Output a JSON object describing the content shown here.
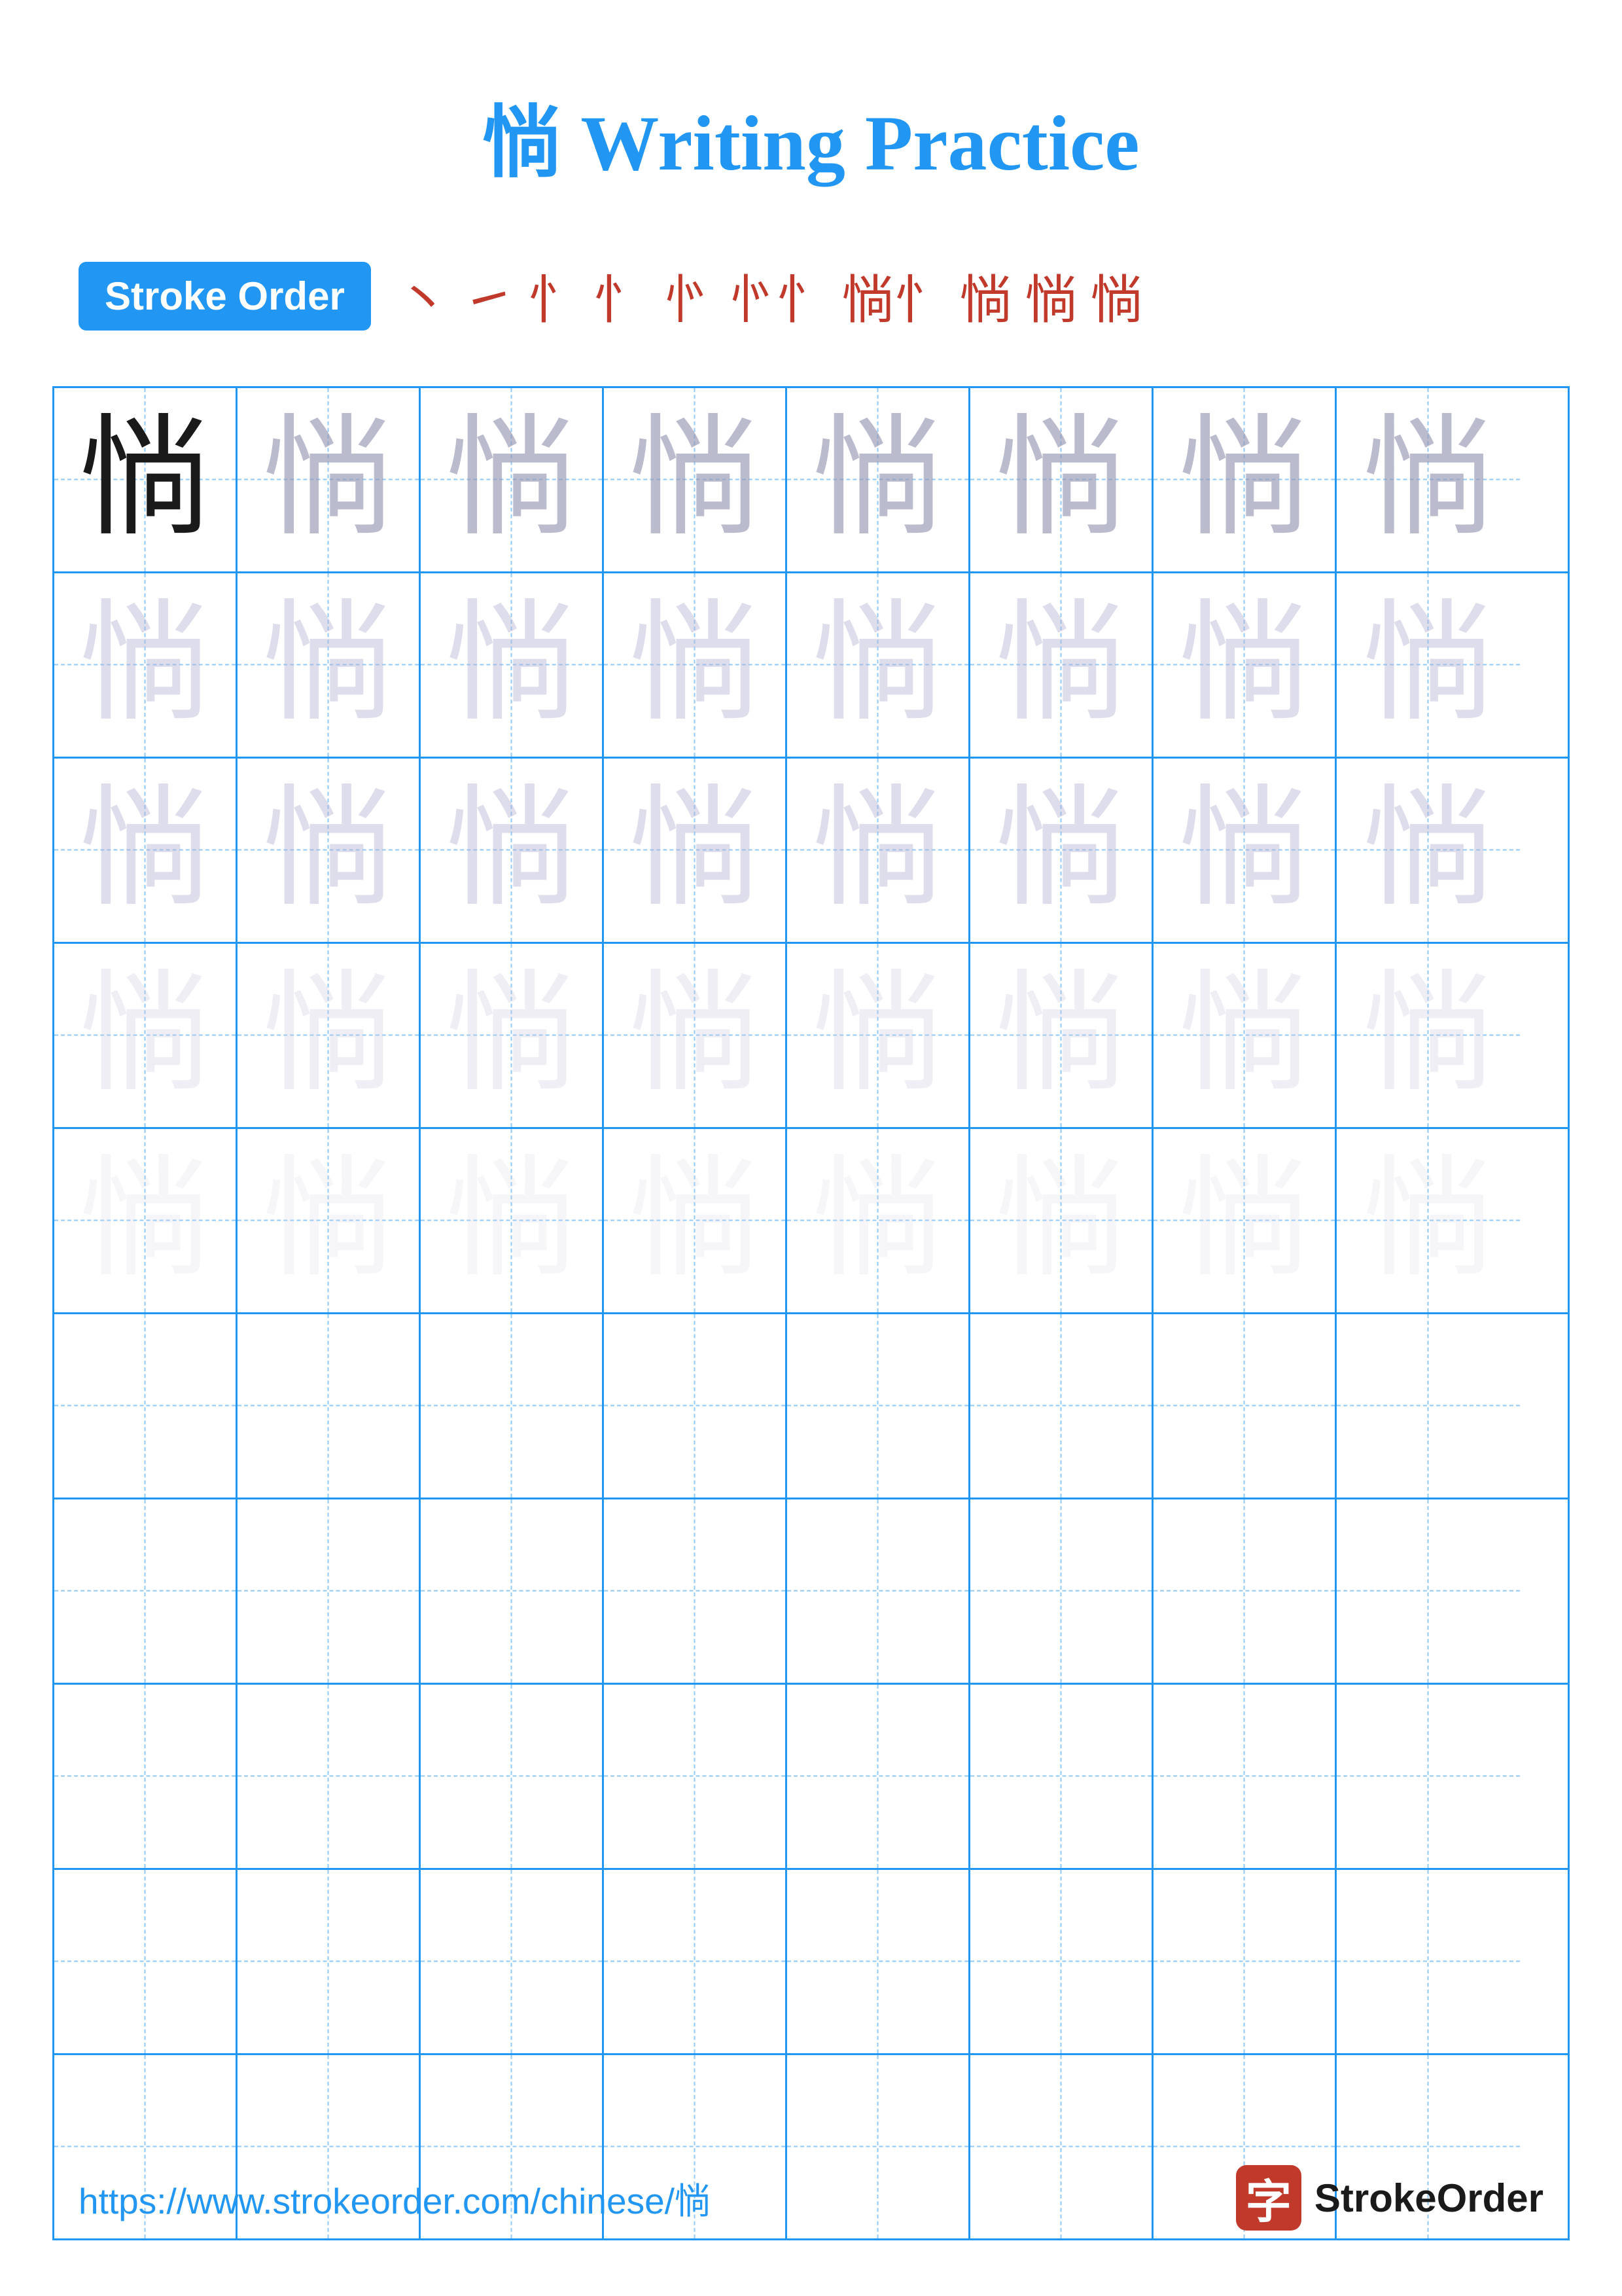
{
  "title": {
    "character": "惝",
    "subtitle": "Writing Practice",
    "full": "惝 Writing Practice"
  },
  "stroke_order": {
    "badge_label": "Stroke Order",
    "strokes": [
      "丶",
      "㇀",
      "忄",
      "忄",
      "忄忄",
      "忄忄",
      "惝忄",
      "惝",
      "惝惝",
      "惝"
    ]
  },
  "grid": {
    "rows": 10,
    "cols": 8,
    "character": "惝"
  },
  "footer": {
    "url": "https://www.strokeorder.com/chinese/惝",
    "logo_text": "StrokeOrder"
  },
  "colors": {
    "accent": "#2196F3",
    "dark_char": "#1a1a1a",
    "light1": "rgba(150,150,180,0.65)",
    "light2": "rgba(180,180,210,0.45)",
    "light3": "rgba(200,200,220,0.30)",
    "stroke_color": "#c0392b"
  }
}
